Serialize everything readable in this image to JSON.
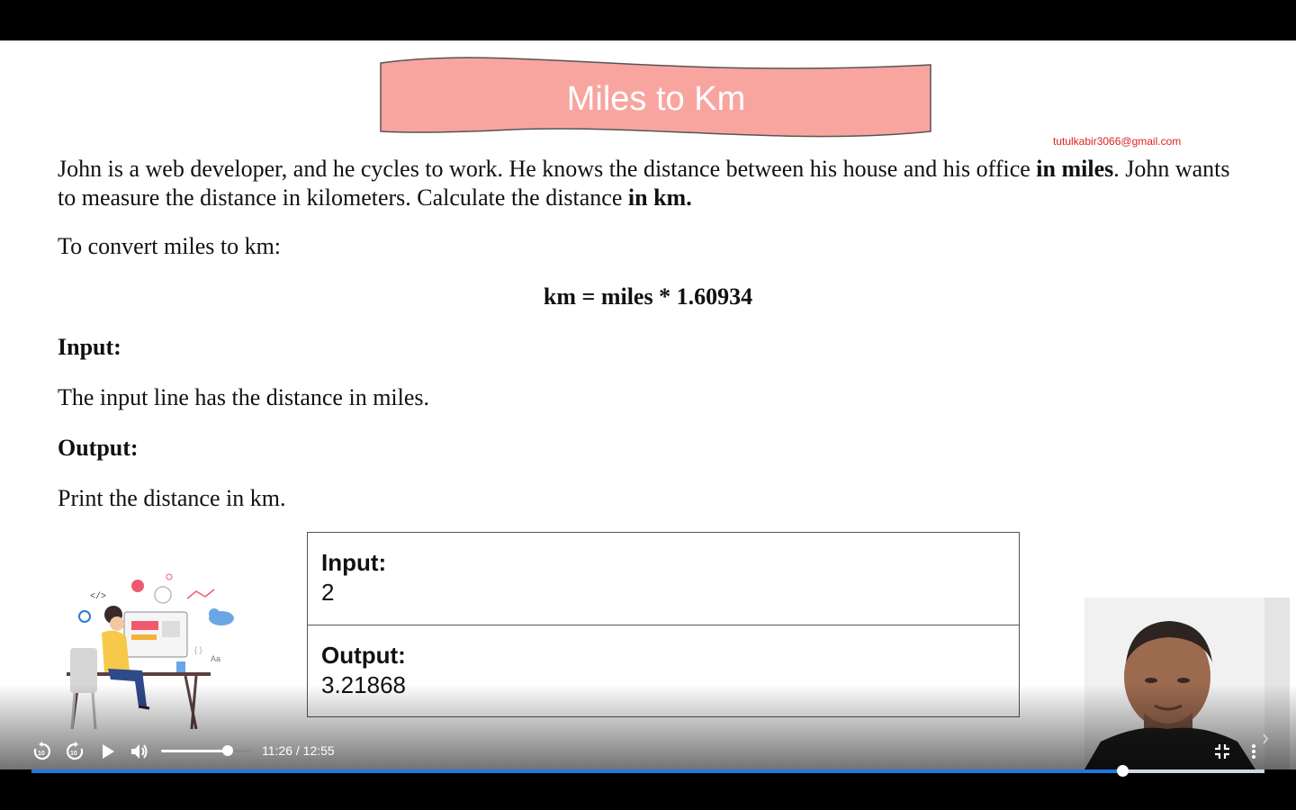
{
  "slide": {
    "title": "Miles to Km",
    "watermark_email": "tutulkabir3066@gmail.com",
    "intro_part1": "John is a web developer, and he cycles to work. He knows the distance between his house and his office ",
    "intro_bold1": "in miles",
    "intro_part2": ". John wants to measure the distance in kilometers. Calculate the distance ",
    "intro_bold2": "in km.",
    "convert_text": "To convert miles to km:",
    "formula": "km = miles * 1.60934",
    "input_heading": "Input:",
    "input_text": "The input line has the distance in miles.",
    "output_heading": "Output:",
    "output_text": "Print the distance in km.",
    "sample": {
      "input_label": "Input:",
      "input_value": "2",
      "output_label": "Output:",
      "output_value": "3.21868"
    },
    "illustration_code_tag": "</>",
    "illustration_aa": "Aa",
    "banner_color": "#f8a5a0"
  },
  "player": {
    "time_display": "11:26 / 12:55",
    "progress_fraction": 0.8847,
    "volume_fraction": 0.74,
    "buttons": {
      "rewind": "replay-10-icon",
      "forward": "forward-10-icon",
      "play": "play-icon",
      "volume": "volume-icon",
      "exit_fullscreen": "exit-fullscreen-icon",
      "more": "more-options-icon",
      "next": "chevron-right-icon"
    },
    "accent_color": "#1e78e8"
  }
}
